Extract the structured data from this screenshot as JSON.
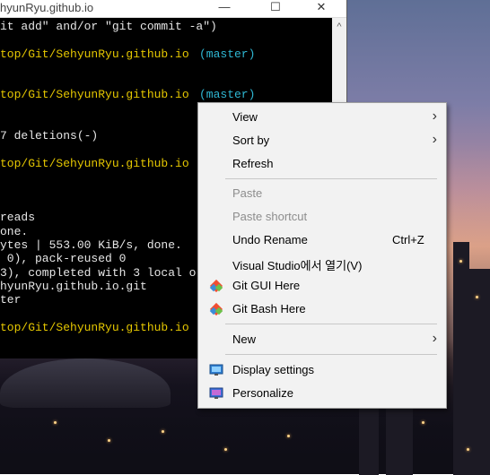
{
  "terminal": {
    "title": "hyunRyu.github.io",
    "scroll_up": "^",
    "lines": [
      "it add\" and/or \"git commit -a\")",
      "top/Git/SehyunRyu.github.io ",
      "(master)",
      "top/Git/SehyunRyu.github.io ",
      "(master)",
      "7 deletions(-)",
      "top/Git/SehyunRyu.github.io",
      "reads",
      "one.",
      "ytes | 553.00 KiB/s, done.",
      " 0), pack-reused 0",
      "3), completed with 3 local o",
      "hyunRyu.github.io.git",
      "ter",
      "top/Git/SehyunRyu.github.io"
    ],
    "window_buttons": {
      "minimize": "—",
      "maximize": "☐",
      "close": "✕"
    }
  },
  "context_menu": {
    "items": [
      {
        "label": "View",
        "submenu": true,
        "enabled": true
      },
      {
        "label": "Sort by",
        "submenu": true,
        "enabled": true
      },
      {
        "label": "Refresh",
        "enabled": true
      },
      {
        "label": "Paste",
        "enabled": false
      },
      {
        "label": "Paste shortcut",
        "enabled": false
      },
      {
        "label": "Undo Rename",
        "shortcut": "Ctrl+Z",
        "enabled": true
      },
      {
        "label": "Visual Studio에서 열기(V)",
        "enabled": true
      },
      {
        "label": "Git GUI Here",
        "icon": "git-icon",
        "enabled": true
      },
      {
        "label": "Git Bash Here",
        "icon": "git-icon",
        "enabled": true
      },
      {
        "label": "New",
        "submenu": true,
        "enabled": true
      },
      {
        "label": "Display settings",
        "icon": "display-icon",
        "enabled": true
      },
      {
        "label": "Personalize",
        "icon": "personalize-icon",
        "enabled": true
      }
    ],
    "chevron": "›"
  },
  "colors": {
    "prompt_yellow": "#e5c700",
    "branch_cyan": "#2fb7d3",
    "menu_bg": "#f2f2f2"
  }
}
